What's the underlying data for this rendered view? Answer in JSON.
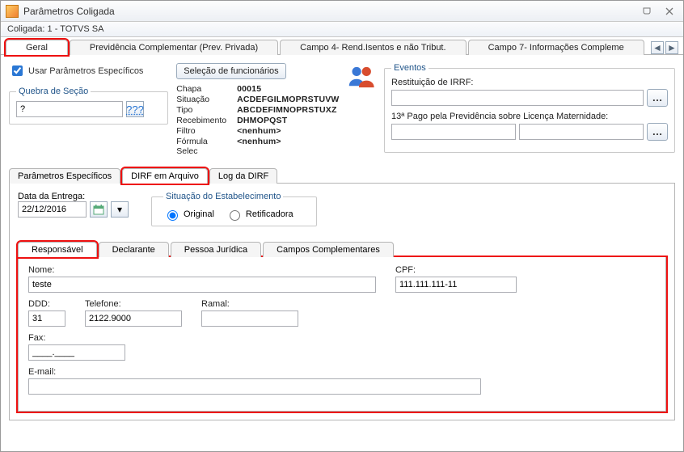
{
  "window": {
    "title": "Parâmetros Coligada",
    "subtitle": "Coligada: 1 - TOTVS SA"
  },
  "mainTabs": [
    {
      "label": "Geral",
      "active": true,
      "name": "tab-geral"
    },
    {
      "label": "Previdência Complementar (Prev. Privada)",
      "name": "tab-prev"
    },
    {
      "label": "Campo 4- Rend.Isentos e não Tribut.",
      "name": "tab-campo4"
    },
    {
      "label": "Campo  7- Informações Compleme",
      "name": "tab-campo7"
    }
  ],
  "checkUseParams": "Usar Parâmetros Específicos",
  "quebra": {
    "legend": "Quebra de Seção",
    "value": "?"
  },
  "selectBtn": "Seleção de funcionários",
  "info": {
    "Chapa": "00015",
    "Situação": "ACDEFGILMOPRSTUVW",
    "Tipo": "ABCDEFIMNOPRSTUXZ",
    "Recebimento": "DHMOPQST",
    "Filtro": "<nenhum>",
    "Fórmula Selec": "<nenhum>"
  },
  "eventos": {
    "legend": "Eventos",
    "restituicao": "Restituição de IRRF:",
    "licmat": "13ª Pago pela Previdência sobre Licença Maternidade:"
  },
  "subTabs": [
    {
      "label": "Parâmetros Específicos",
      "name": "subtab-param-esp"
    },
    {
      "label": "DIRF em Arquivo",
      "active": true,
      "name": "subtab-dirf-arq"
    },
    {
      "label": "Log da DIRF",
      "name": "subtab-log"
    }
  ],
  "mid": {
    "dataEntregaLabel": "Data da Entrega:",
    "dataEntrega": "22/12/2016",
    "situacaoLegend": "Situação do Estabelecimento",
    "radioOriginal": "Original",
    "radioRetif": "Retificadora"
  },
  "innerTabs": [
    {
      "label": "Responsável",
      "active": true,
      "name": "itab-resp"
    },
    {
      "label": "Declarante",
      "name": "itab-decl"
    },
    {
      "label": "Pessoa Jurídica",
      "name": "itab-pj"
    },
    {
      "label": "Campos  Complementares",
      "name": "itab-compl"
    }
  ],
  "form": {
    "nomeLabel": "Nome:",
    "nome": "teste",
    "cpfLabel": "CPF:",
    "cpf": "111.111.111-11",
    "dddLabel": "DDD:",
    "ddd": "31",
    "telLabel": "Telefone:",
    "tel": "2122.9000",
    "ramalLabel": "Ramal:",
    "ramal": "",
    "faxLabel": "Fax:",
    "fax": "____.____",
    "emailLabel": "E-mail:",
    "email": ""
  }
}
